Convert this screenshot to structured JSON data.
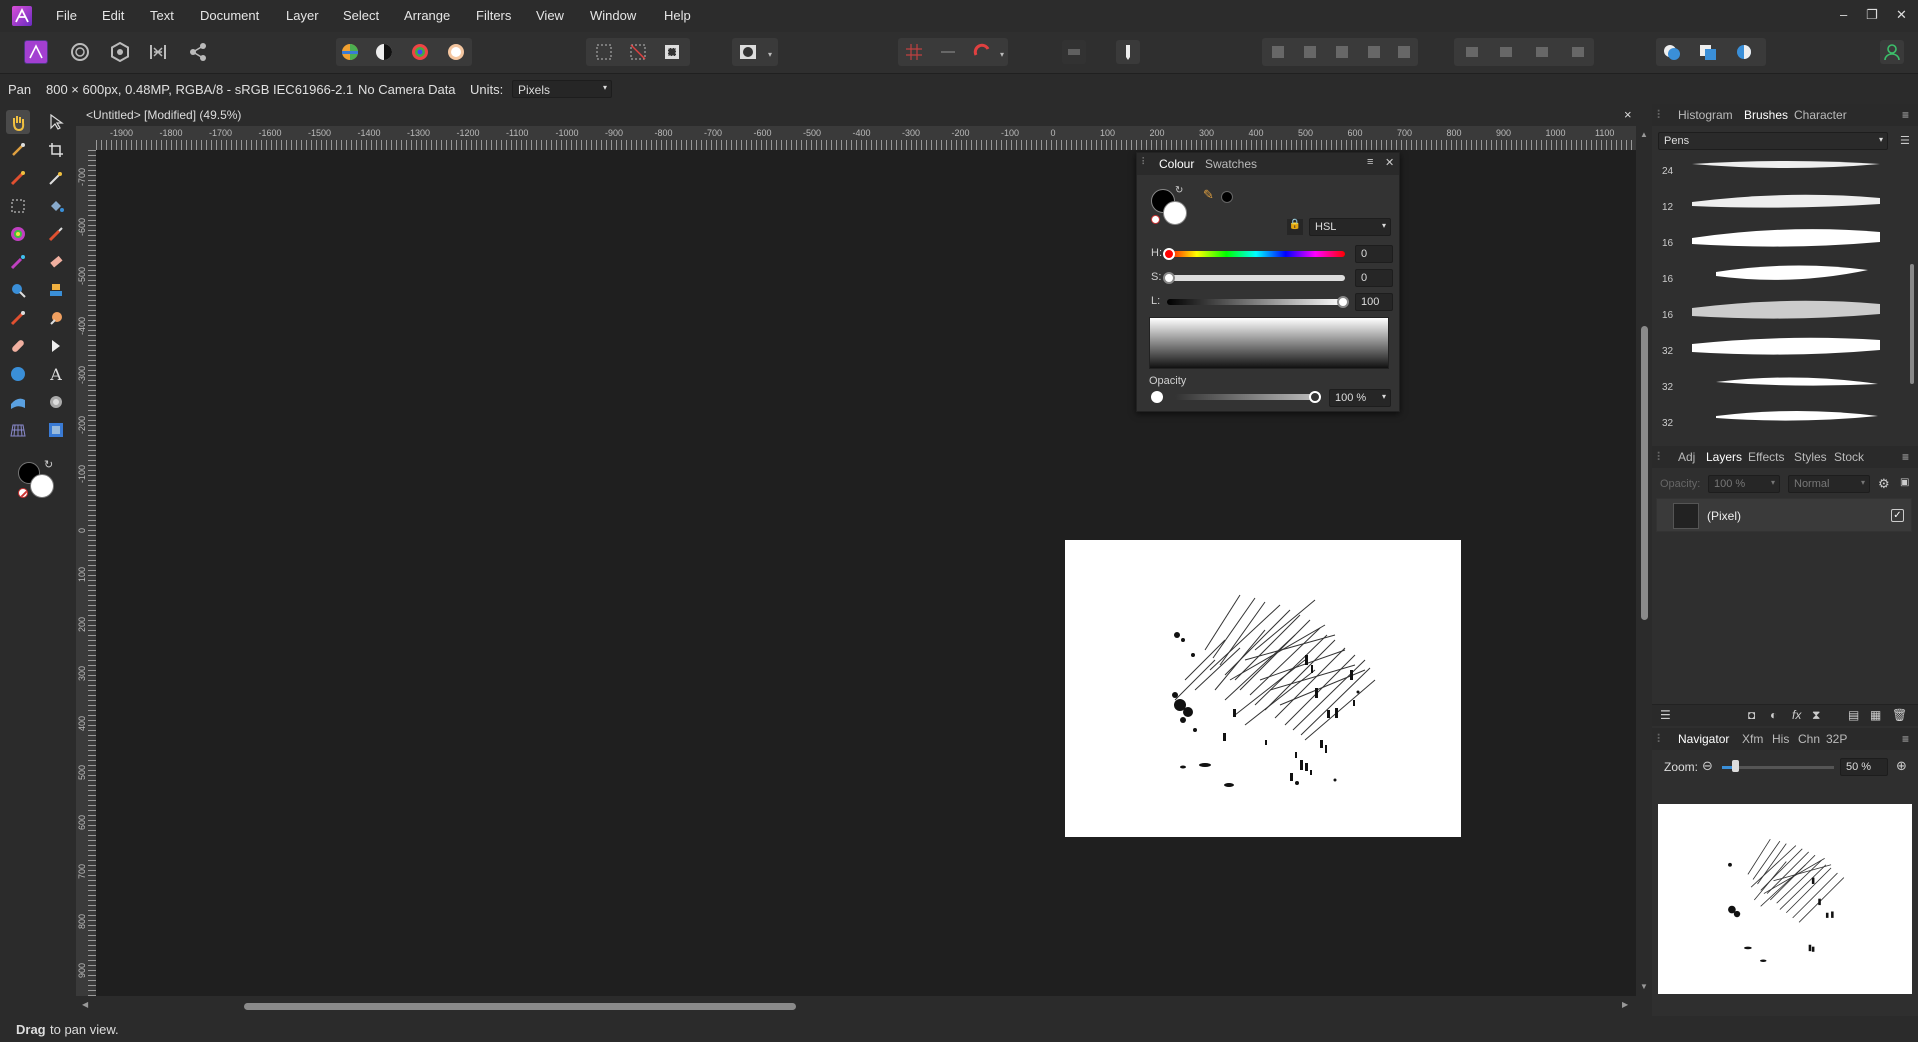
{
  "app": {
    "name": "Affinity Photo"
  },
  "menu": [
    "File",
    "Edit",
    "Text",
    "Document",
    "Layer",
    "Select",
    "Arrange",
    "Filters",
    "View",
    "Window",
    "Help"
  ],
  "context": {
    "tool": "Pan",
    "doc_info": "800 × 600px, 0.48MP, RGBA/8 - sRGB IEC61966-2.1",
    "camera": "No Camera Data",
    "units_label": "Units:",
    "units_value": "Pixels"
  },
  "document": {
    "tab_title": "<Untitled> [Modified] (49.5%)",
    "close": "×"
  },
  "rulers": {
    "h_labels": [
      "-1900",
      "-1800",
      "-1700",
      "-1600",
      "-1500",
      "-1400",
      "-1300",
      "-1200",
      "-1100",
      "-1000",
      "-900",
      "-800",
      "-700",
      "-600",
      "-500",
      "-400",
      "-300",
      "-200",
      "-100",
      "0",
      "100",
      "200",
      "300",
      "400",
      "500",
      "600",
      "700",
      "800",
      "900",
      "1000",
      "1100"
    ],
    "v_labels": [
      "-700",
      "-600",
      "-500",
      "-400",
      "-300",
      "-200",
      "-100",
      "0",
      "100",
      "200",
      "300",
      "400",
      "500",
      "600",
      "700",
      "800",
      "900"
    ],
    "unit": "px"
  },
  "colour_panel": {
    "tabs": [
      "Colour",
      "Swatches"
    ],
    "active_tab": "Colour",
    "model": "HSL",
    "h_label": "H:",
    "h_value": "0",
    "s_label": "S:",
    "s_value": "0",
    "l_label": "L:",
    "l_value": "100",
    "opacity_label": "Opacity",
    "opacity_value": "100 %",
    "primary_color": "#000000",
    "secondary_color": "#ffffff"
  },
  "top_panel": {
    "tabs": [
      "Histogram",
      "Brushes",
      "Character"
    ],
    "active_tab": "Brushes",
    "category": "Pens",
    "brush_sizes": [
      "24",
      "12",
      "16",
      "16",
      "16",
      "32",
      "32",
      "32"
    ]
  },
  "layers_panel": {
    "tabs": [
      "Adj",
      "Layers",
      "Effects",
      "Styles",
      "Stock"
    ],
    "active_tab": "Layers",
    "opacity_label": "Opacity:",
    "opacity_value": "100 %",
    "blend_mode": "Normal",
    "layers": [
      {
        "name": "(Pixel)",
        "visible": true
      }
    ]
  },
  "navigator_panel": {
    "tabs": [
      "Navigator",
      "Xfm",
      "His",
      "Chn",
      "32P"
    ],
    "active_tab": "Navigator",
    "zoom_label": "Zoom:",
    "zoom_value": "50 %",
    "zoom_level": 0.12
  },
  "status": {
    "bold": "Drag",
    "rest": "to pan view."
  }
}
